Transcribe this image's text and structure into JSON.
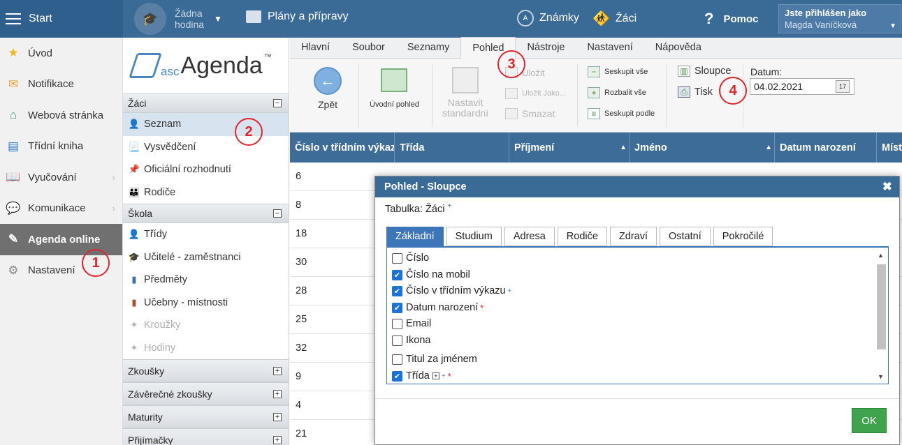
{
  "topbar": {
    "start_label": "Start",
    "hour_line1": "Žádna",
    "hour_line2": "hodina",
    "plans_label": "Plány a přípravy",
    "grades_label": "Známky",
    "pupils_label": "Žáci",
    "help_label": "Pomoc",
    "logged_as_label": "Jste přihlášen jako",
    "user_name": "Magda Vaníčková"
  },
  "leftnav": {
    "items": [
      {
        "label": "Úvod"
      },
      {
        "label": "Notifikace"
      },
      {
        "label": "Webová stránka"
      },
      {
        "label": "Třídní kniha"
      },
      {
        "label": "Vyučování"
      },
      {
        "label": "Komunikace"
      },
      {
        "label": "Agenda online"
      },
      {
        "label": "Nastavení"
      }
    ]
  },
  "logo": {
    "prefix": "asc",
    "name": "Agenda",
    "tm": "™"
  },
  "midnav": {
    "zaci": "Žáci",
    "seznam": "Seznam",
    "vysvedceni": "Vysvědčení",
    "oficialni": "Oficiální rozhodnutí",
    "rodice": "Rodiče",
    "skola": "Škola",
    "tridy": "Třídy",
    "ucitele": "Učitelé - zaměstnanci",
    "predmety": "Předměty",
    "ucebny": "Učebny - místnosti",
    "krouzky": "Kroužky",
    "hodiny": "Hodiny",
    "zkousky": "Zkoušky",
    "zaverecne": "Závěrečné zkoušky",
    "maturity": "Maturity",
    "prijimacky": "Přijímačky"
  },
  "menubar": {
    "items": [
      "Hlavní",
      "Soubor",
      "Seznamy",
      "Pohled",
      "Nástroje",
      "Nastavení",
      "Nápověda"
    ]
  },
  "ribbon": {
    "back": "Zpět",
    "home_view": "Úvodní pohled",
    "set_std_1": "Nastavit",
    "set_std_2": "standardní",
    "save": "Uložit",
    "save_as": "Uložit Jako...",
    "delete": "Smazat",
    "group_all": "Seskupit vše",
    "expand_all": "Rozbalit vše",
    "group_by": "Seskupit podle",
    "columns": "Sloupce",
    "print": "Tisk",
    "date_label": "Datum:",
    "date_value": "04.02.2021"
  },
  "table": {
    "headers": [
      "Číslo v třídním výkazu",
      "Třída",
      "Příjmení",
      "Jméno",
      "Datum narození",
      "Místo"
    ],
    "rows": [
      "6",
      "8",
      "18",
      "30",
      "28",
      "25",
      "32",
      "9",
      "4",
      "21"
    ]
  },
  "dialog": {
    "title": "Pohled - Sloupce",
    "table_label": "Tabulka: Žáci",
    "plus": "+",
    "tabs": [
      "Základní",
      "Studium",
      "Adresa",
      "Rodiče",
      "Zdraví",
      "Ostatní",
      "Pokročilé"
    ],
    "options": [
      {
        "label": "Číslo",
        "checked": false
      },
      {
        "label": "Číslo na mobil",
        "checked": true
      },
      {
        "label": "Číslo v třídním výkazu",
        "checked": true
      },
      {
        "label": "Datum narození",
        "checked": true
      },
      {
        "label": "Email",
        "checked": false
      },
      {
        "label": "Ikona",
        "checked": false
      },
      {
        "label": "Titul za jménem",
        "checked": false
      },
      {
        "label": "Třída",
        "checked": true
      }
    ],
    "ok": "OK"
  },
  "markers": [
    "1",
    "2",
    "3",
    "4"
  ],
  "colors": {
    "topbar": "#3a6a96",
    "accent": "#3d76b8",
    "marker": "#e0252b",
    "ok": "#3fa34d"
  }
}
